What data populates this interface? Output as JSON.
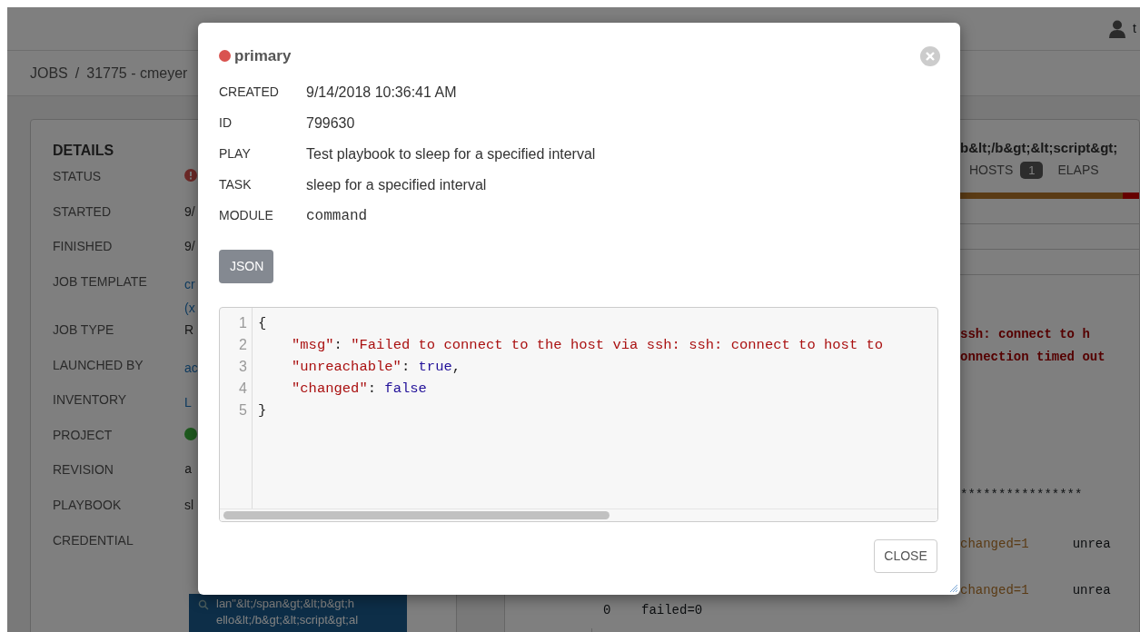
{
  "background": {
    "header": {
      "user_text": "t"
    },
    "breadcrumb": {
      "link": "JOBS",
      "separator": "/",
      "current": "31775 - cmeyer"
    },
    "details": {
      "title": "DETAILS",
      "rows": [
        {
          "label": "STATUS",
          "kind": "error-icon"
        },
        {
          "label": "STARTED",
          "kind": "text",
          "value": "9/"
        },
        {
          "label": "FINISHED",
          "kind": "text",
          "value": "9/"
        },
        {
          "label": "JOB TEMPLATE",
          "kind": "link",
          "value": "cr",
          "second_value": "(x"
        },
        {
          "label": "JOB TYPE",
          "kind": "text",
          "value": "R"
        },
        {
          "label": "LAUNCHED BY",
          "kind": "link",
          "value": "ac"
        },
        {
          "label": "INVENTORY",
          "kind": "link",
          "value": "L"
        },
        {
          "label": "PROJECT",
          "kind": "success-dot"
        },
        {
          "label": "REVISION",
          "kind": "mono",
          "value": "a"
        },
        {
          "label": "PLAYBOOK",
          "kind": "text",
          "value": "sl"
        },
        {
          "label": "CREDENTIAL",
          "kind": "tag",
          "lines": [
            "lan\"&lt;/span&gt;&lt;b&gt;h",
            "ello&lt;/b&gt;&lt;script&gt;al"
          ]
        }
      ]
    },
    "output": {
      "title": "b&lt;/b&gt;&lt;script&gt;",
      "progress": {
        "level": 0.91
      },
      "counts": [
        {
          "label": "HOSTS",
          "badge": "1"
        },
        {
          "label": "ELAPS"
        }
      ],
      "error_lines": [
        "ssh: connect to h",
        "onnection timed out"
      ],
      "separator": "****************",
      "recap_lines": [
        {
          "changed": "changed=1",
          "rest": "unrea"
        },
        {
          "changed": "changed=1",
          "rest": "unrea"
        }
      ],
      "tail_line": "0    failed=0"
    }
  },
  "modal": {
    "failed": true,
    "title": "primary",
    "fields": [
      {
        "label": "CREATED",
        "value": "9/14/2018 10:36:41 AM",
        "kind": "text"
      },
      {
        "label": "ID",
        "value": "799630",
        "kind": "text"
      },
      {
        "label": "PLAY",
        "value": "Test playbook to sleep for a specified interval",
        "kind": "text"
      },
      {
        "label": "TASK",
        "value": "sleep for a specified interval",
        "kind": "text"
      },
      {
        "label": "MODULE",
        "value": "command",
        "kind": "mono"
      }
    ],
    "tab_button": "JSON",
    "code_lines": [
      {
        "number": "1",
        "indented": false,
        "tokens": [
          {
            "kind": "punct",
            "text": "{"
          }
        ]
      },
      {
        "number": "2",
        "indented": true,
        "tokens": [
          {
            "kind": "key",
            "text": "\"msg\""
          },
          {
            "kind": "punct",
            "text": ": "
          },
          {
            "kind": "string",
            "text": "\"Failed to connect to the host via ssh: ssh: connect to host to"
          }
        ]
      },
      {
        "number": "3",
        "indented": true,
        "tokens": [
          {
            "kind": "key",
            "text": "\"unreachable\""
          },
          {
            "kind": "punct",
            "text": ": "
          },
          {
            "kind": "atom",
            "text": "true"
          },
          {
            "kind": "punct",
            "text": ","
          }
        ]
      },
      {
        "number": "4",
        "indented": true,
        "tokens": [
          {
            "kind": "key",
            "text": "\"changed\""
          },
          {
            "kind": "punct",
            "text": ": "
          },
          {
            "kind": "atom",
            "text": "false"
          }
        ]
      },
      {
        "number": "5",
        "indented": false,
        "tokens": [
          {
            "kind": "punct",
            "text": "}"
          }
        ]
      }
    ],
    "close_button": "CLOSE"
  }
}
